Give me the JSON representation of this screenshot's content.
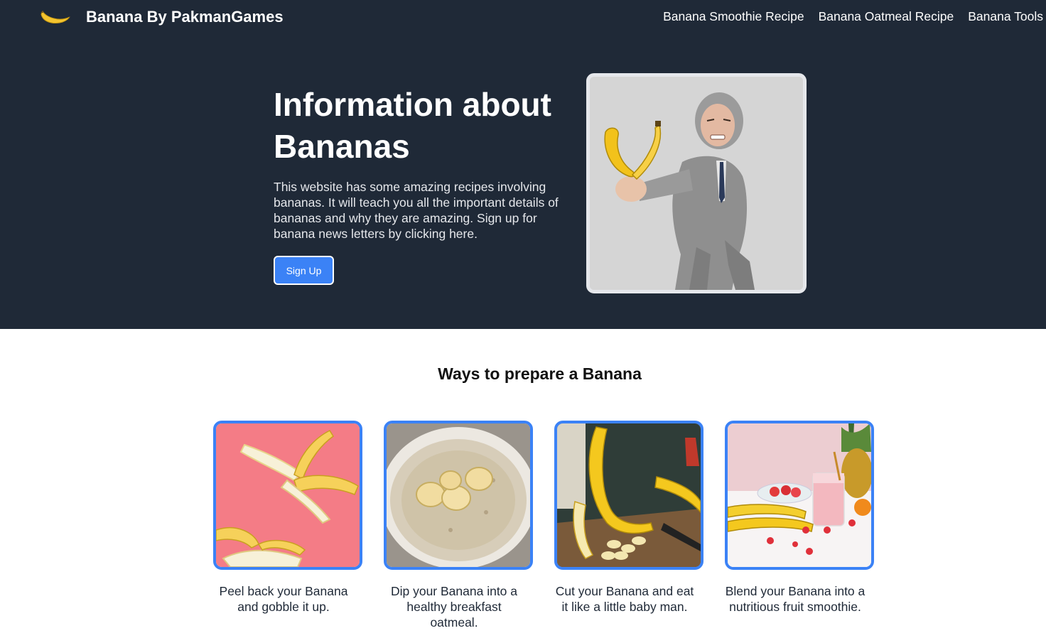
{
  "header": {
    "logo_icon": "banana-icon",
    "title": "Banana By PakmanGames",
    "nav": [
      {
        "label": "Banana Smoothie Recipe"
      },
      {
        "label": "Banana Oatmeal Recipe"
      },
      {
        "label": "Banana Tools"
      }
    ]
  },
  "hero": {
    "title": "Information about Bananas",
    "text": "This website has some amazing recipes involving bananas. It will teach you all the important details of bananas and why they are amazing. Sign up for banana news letters by clicking here.",
    "button_label": "Sign Up"
  },
  "ways": {
    "title": "Ways to prepare a Banana",
    "cards": [
      {
        "caption": "Peel back your Banana and gobble it up."
      },
      {
        "caption": "Dip your Banana into a healthy breakfast oatmeal."
      },
      {
        "caption": "Cut your Banana and eat it like a little baby man."
      },
      {
        "caption": "Blend your Banana into a nutritious fruit smoothie."
      }
    ]
  },
  "colors": {
    "hero_bg": "#1f2937",
    "accent": "#3b82f6",
    "text_light": "#ffffff"
  }
}
